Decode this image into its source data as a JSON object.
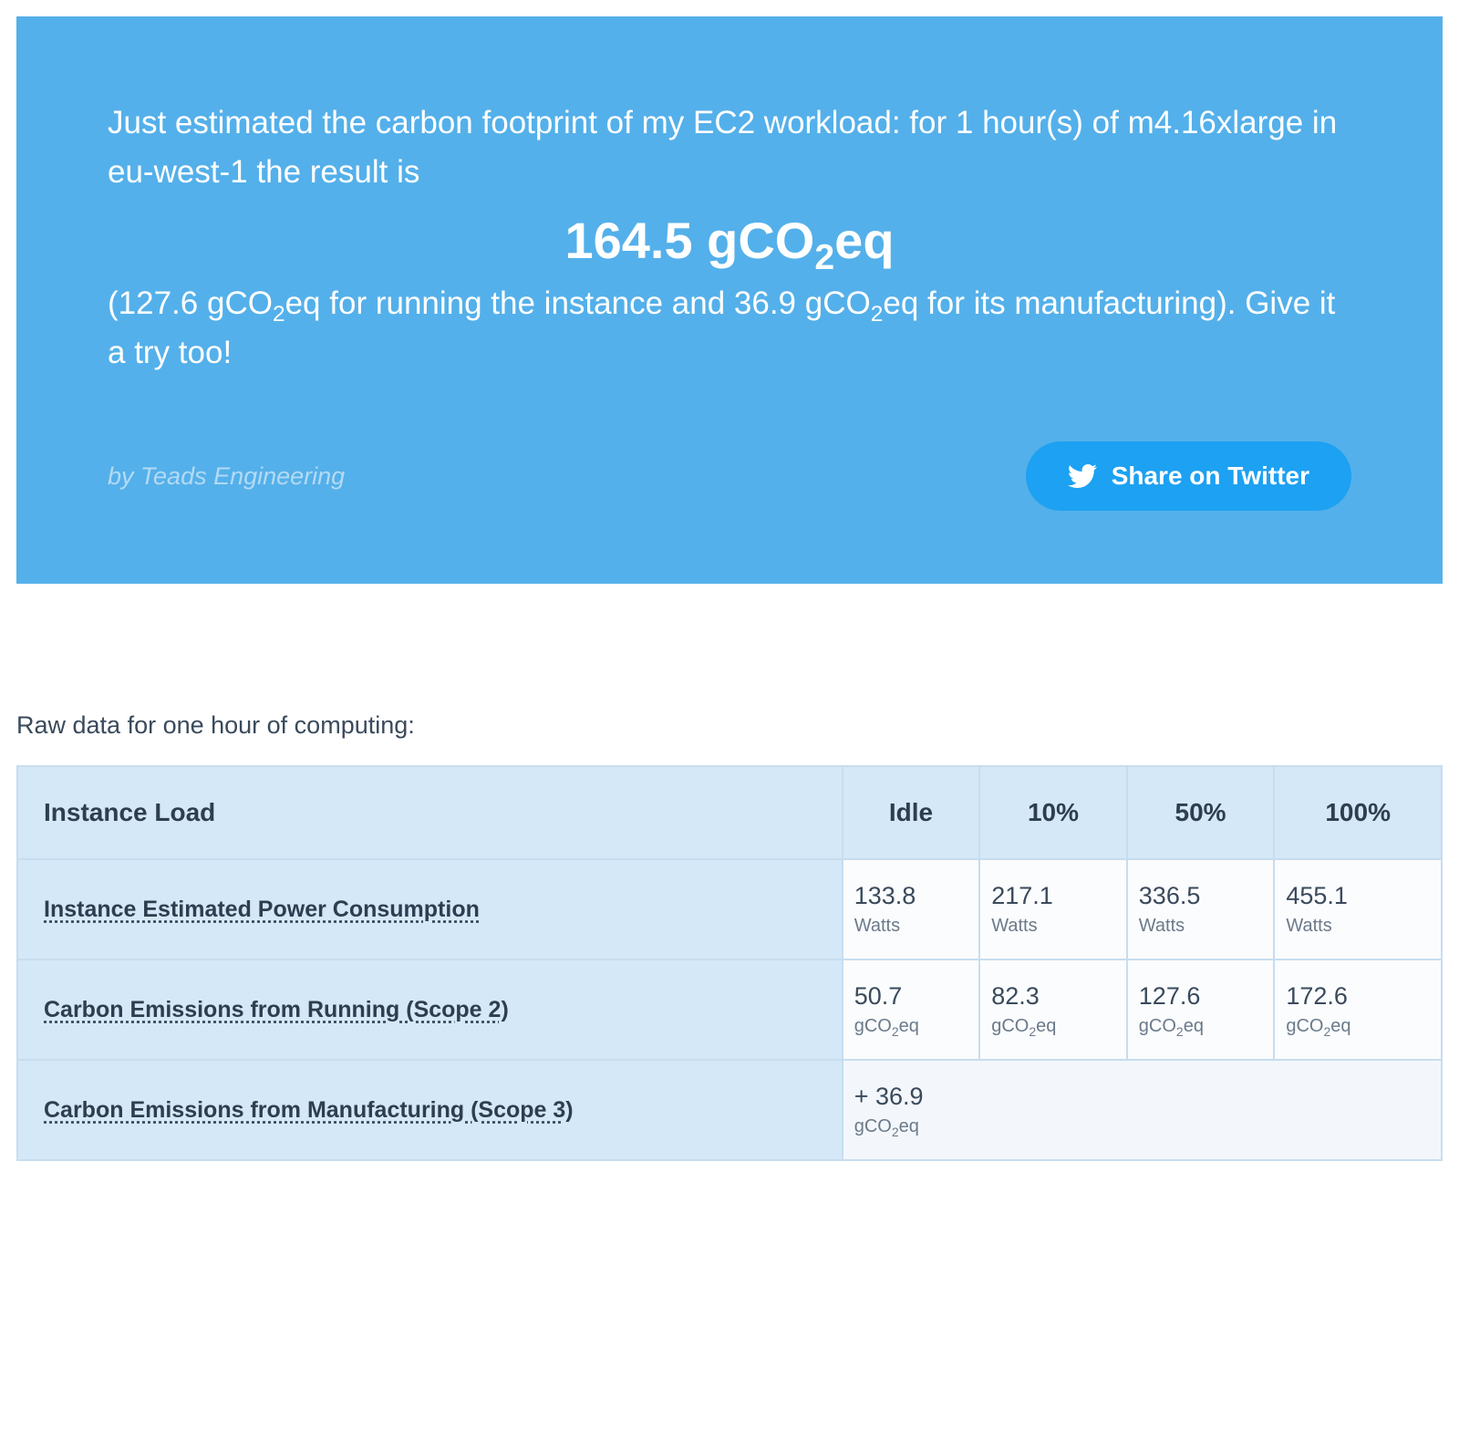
{
  "share": {
    "line1_pre": "Just estimated the carbon footprint of my EC2 workload: for ",
    "hours": "1",
    "line1_mid": " hour(s) of ",
    "instance_type": "m4.16xlarge",
    "line1_in": " in ",
    "region": "eu-west-1",
    "line1_post": " the result is",
    "result_value": "164.5",
    "result_unit_pre": "gCO",
    "result_unit_sub": "2",
    "result_unit_post": "eq",
    "detail_pre": "(",
    "running_value": "127.6",
    "detail_unit_pre": " gCO",
    "detail_unit_sub": "2",
    "detail_unit_post": "eq",
    "detail_mid": " for running the instance and ",
    "manufacturing_value": "36.9",
    "detail_post": " for its manufacturing). Give it a try too!",
    "byline": "by Teads Engineering",
    "twitter_label": "Share on Twitter"
  },
  "raw_label": "Raw data for one hour of computing:",
  "table": {
    "header_row": "Instance Load",
    "headers": [
      "Idle",
      "10%",
      "50%",
      "100%"
    ],
    "row_power": {
      "label": "Instance Estimated Power Consumption",
      "unit": "Watts",
      "values": [
        "133.8",
        "217.1",
        "336.5",
        "455.1"
      ]
    },
    "row_scope2": {
      "label": "Carbon Emissions from Running (Scope 2)",
      "unit_pre": "gCO",
      "unit_sub": "2",
      "unit_post": "eq",
      "values": [
        "50.7",
        "82.3",
        "127.6",
        "172.6"
      ]
    },
    "row_scope3": {
      "label": "Carbon Emissions from Manufacturing (Scope 3)",
      "value": "+ 36.9",
      "unit_pre": "gCO",
      "unit_sub": "2",
      "unit_post": "eq"
    }
  }
}
